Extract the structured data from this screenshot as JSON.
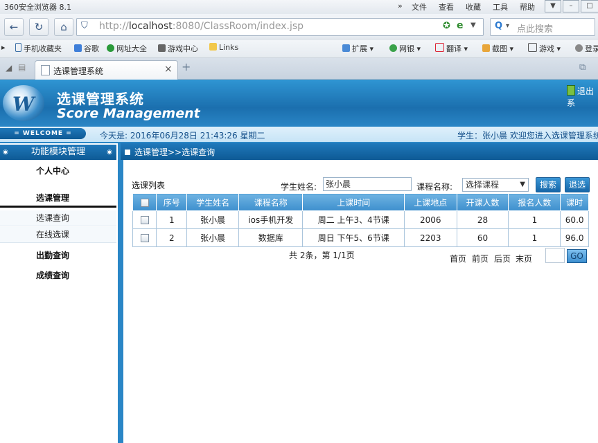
{
  "browser": {
    "title": "360安全浏览器 8.1",
    "menu": [
      "文件",
      "查看",
      "收藏",
      "工具",
      "帮助"
    ],
    "url_prefix": "http://",
    "url_host": "localhost",
    "url_rest": ":8080/ClassRoom/index.jsp",
    "search_placeholder": "点此搜索",
    "bookmarks": [
      "手机收藏夹",
      "谷歌",
      "网址大全",
      "游戏中心",
      "Links"
    ],
    "right_tools": [
      "扩展",
      "网银",
      "翻译",
      "截图",
      "游戏",
      "登录"
    ],
    "tab_title": "选课管理系统"
  },
  "app": {
    "title_cn": "选课管理系统",
    "title_en": "Score Management",
    "exit_label": "退出系",
    "welcome_tag": "= WELCOME =",
    "today": "今天是: 2016年06月28日   21:43:26   星期二",
    "welcome_msg": "学生：张小晨   欢迎您进入选课管理系统"
  },
  "sidebar": {
    "header": "功能模块管理",
    "personal_center": "个人中心",
    "course_mgmt": "选课管理",
    "sub_items": [
      "选课查询",
      "在线选课"
    ],
    "attendance": "出勤查询",
    "grades": "成绩查询"
  },
  "content": {
    "breadcrumb": "选课管理>>选课查询",
    "list_title": "选课列表",
    "student_label": "学生姓名:",
    "student_value": "张小晨",
    "course_label": "课程名称:",
    "course_value": "选择课程",
    "search_button": "搜索",
    "drop_button": "退选",
    "columns": [
      "序号",
      "学生姓名",
      "课程名称",
      "上课时间",
      "上课地点",
      "开课人数",
      "报名人数",
      "课时"
    ],
    "rows": [
      [
        "1",
        "张小晨",
        "ios手机开发",
        "周二 上午3、4节课",
        "2006",
        "28",
        "1",
        "60.0"
      ],
      [
        "2",
        "张小晨",
        "数据库",
        "周日 下午5、6节课",
        "2203",
        "60",
        "1",
        "96.0"
      ]
    ],
    "pager_info": "共 2条，第 1/1页",
    "pager": {
      "first": "首页",
      "prev": "前页",
      "next": "后页",
      "last": "末页",
      "go": "GO"
    }
  },
  "colors": {
    "header_blue": "#1b6fae",
    "accent": "#2a86c6"
  }
}
